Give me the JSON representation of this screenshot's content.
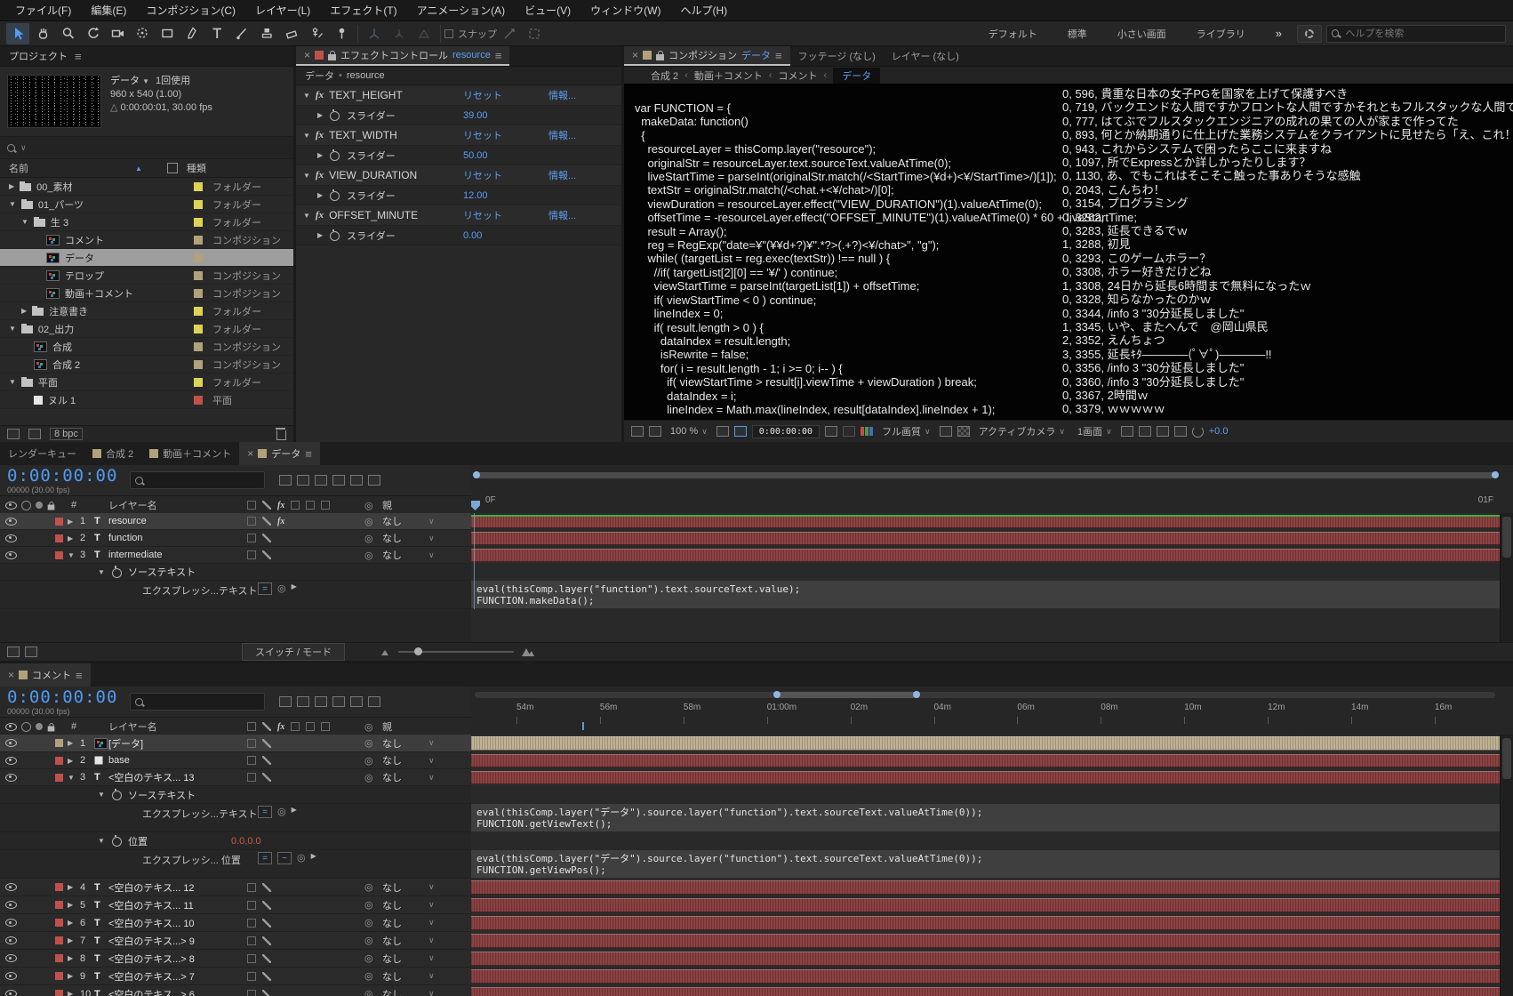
{
  "colors": {
    "accent_blue": "#5c9ff2",
    "timecode_blue": "#4f9bf5",
    "label_yellow": "#ddd453",
    "label_tan": "#b1a27c",
    "label_red": "#c0504a",
    "bar_red": "#8a4141",
    "bar_tan": "#bfb294",
    "green_line": "#3fae3f",
    "value_red": "#d05a50"
  },
  "menu_bar": {
    "items": [
      "ファイル(F)",
      "編集(E)",
      "コンポジション(C)",
      "レイヤー(L)",
      "エフェクト(T)",
      "アニメーション(A)",
      "ビュー(V)",
      "ウィンドウ(W)",
      "ヘルプ(H)"
    ]
  },
  "toolbar": {
    "snap_label": "スナップ",
    "workspaces": [
      "デフォルト",
      "標準",
      "小さい画面",
      "ライブラリ"
    ],
    "overflow": "»",
    "help_search_placeholder": "ヘルプを検索",
    "tools": [
      "selection",
      "hand",
      "zoom",
      "rotate",
      "camera",
      "orbit",
      "rectangle",
      "pen",
      "type",
      "brush",
      "stamp",
      "eraser",
      "roto-brush",
      "puppet-pin"
    ]
  },
  "project_panel": {
    "title": "プロジェクト",
    "preview": {
      "name": "データ",
      "usage": "1回使用",
      "dimensions": "960 x 540 (1.00)",
      "duration": "0:00:00:01, 30.00 fps"
    },
    "columns": {
      "name": "名前",
      "type": "種類"
    },
    "type_folder": "フォルダー",
    "type_comp": "コンポジション",
    "type_solid": "平面",
    "rows": [
      {
        "depth": 0,
        "exp": "r",
        "icon": "folder",
        "name": "00_素材",
        "color": "yellow",
        "type": "フォルダー"
      },
      {
        "depth": 0,
        "exp": "d",
        "icon": "folder",
        "name": "01_パーツ",
        "color": "yellow",
        "type": "フォルダー"
      },
      {
        "depth": 1,
        "exp": "d",
        "icon": "folder",
        "name": "生 3",
        "color": "yellow",
        "type": "フォルダー"
      },
      {
        "depth": 2,
        "exp": "",
        "icon": "comp",
        "name": "コメント",
        "color": "tan",
        "type": "コンポジション"
      },
      {
        "depth": 2,
        "exp": "",
        "icon": "comp",
        "name": "データ",
        "color": "tan",
        "type": "コンポジション",
        "selected": true
      },
      {
        "depth": 2,
        "exp": "",
        "icon": "comp",
        "name": "テロップ",
        "color": "tan",
        "type": "コンポジション"
      },
      {
        "depth": 2,
        "exp": "",
        "icon": "comp",
        "name": "動画＋コメント",
        "color": "tan",
        "type": "コンポジション"
      },
      {
        "depth": 1,
        "exp": "r",
        "icon": "folder",
        "name": "注意書き",
        "color": "yellow",
        "type": "フォルダー"
      },
      {
        "depth": 0,
        "exp": "d",
        "icon": "folder",
        "name": "02_出力",
        "color": "yellow",
        "type": "フォルダー"
      },
      {
        "depth": 1,
        "exp": "",
        "icon": "comp",
        "name": "合成",
        "color": "tan",
        "type": "コンポジション"
      },
      {
        "depth": 1,
        "exp": "",
        "icon": "comp",
        "name": "合成 2",
        "color": "tan",
        "type": "コンポジション"
      },
      {
        "depth": 0,
        "exp": "d",
        "icon": "folder",
        "name": "平面",
        "color": "yellow",
        "type": "フォルダー"
      },
      {
        "depth": 1,
        "exp": "",
        "icon": "solid",
        "name": "ヌル 1",
        "color": "red",
        "type": "平面"
      }
    ],
    "footer": {
      "bpc": "8 bpc"
    }
  },
  "effect_controls": {
    "tab_title": "エフェクトコントロール",
    "tab_target": "resource",
    "comp_name": "データ",
    "layer_name": "resource",
    "reset_label": "リセット",
    "info_label": "情報...",
    "slider_label": "スライダー",
    "effects": [
      {
        "name": "TEXT_HEIGHT",
        "value": "39.00"
      },
      {
        "name": "TEXT_WIDTH",
        "value": "50.00"
      },
      {
        "name": "VIEW_DURATION",
        "value": "12.00"
      },
      {
        "name": "OFFSET_MINUTE",
        "value": "0.00"
      }
    ]
  },
  "viewer": {
    "tab_comp_label": "コンポジション",
    "tab_comp_name": "データ",
    "tab_footage": "フッテージ (なし)",
    "tab_layer": "レイヤー (なし)",
    "breadcrumb": [
      "合成 2",
      "動画＋コメント",
      "コメント",
      "データ"
    ],
    "code_lines": [
      "var FUNCTION = {",
      "  makeData: function()",
      "  {",
      "    resourceLayer = thisComp.layer(\"resource\");",
      "    originalStr = resourceLayer.text.sourceText.valueAtTime(0);",
      "    liveStartTime = parseInt(originalStr.match(/<StartTime>(¥d+)<¥/StartTime>/)[1]);",
      "    textStr = originalStr.match(/<chat.+<¥/chat>/)[0];",
      "    viewDuration = resourceLayer.effect(\"VIEW_DURATION\")(1).valueAtTime(0);",
      "    offsetTime = -resourceLayer.effect(\"OFFSET_MINUTE\")(1).valueAtTime(0) * 60 + liveStartTime;",
      "    result = Array();",
      "    reg = RegExp(\"date=¥\"(¥¥d+?)¥\".*?>(.+?)<¥/chat>\", \"g\");",
      "    while( (targetList = reg.exec(textStr)) !== null ) {",
      "      //if( targetList[2][0] == '¥/' ) continue;",
      "      viewStartTime = parseInt(targetList[1]) + offsetTime;",
      "      if( viewStartTime < 0 ) continue;",
      "      lineIndex = 0;",
      "      if( result.length > 0 ) {",
      "        dataIndex = result.length;",
      "        isRewrite = false;",
      "        for( i = result.length - 1; i >= 0; i-- ) {",
      "          if( viewStartTime > result[i].viewTime + viewDuration ) break;",
      "          dataIndex = i;",
      "          lineIndex = Math.max(lineIndex, result[dataIndex].lineIndex + 1);"
    ],
    "chat_lines": [
      "0, 596, 貴重な日本の女子PGを国家を上げて保護すべき",
      "0, 719, バックエンドな人間ですかフロントな人間ですかそれともフルスタックな人間で",
      "0, 777, はてぶでフルスタックエンジニアの成れの果ての人が家まで作ってた",
      "0, 893, 何とか納期通りに仕上げた業務システムをクライアントに見せたら「え、これ！",
      "0, 943, これからシステムで困ったらここに来ますね",
      "0, 1097, 所でExpressとか詳しかったりします？",
      "0, 1130, あ、でもこれはそこそこ触った事ありそうな感触",
      "0, 2043, こんちわ！",
      "0, 3154, プログラミング",
      "0, 3262, ",
      "0, 3283, 延長できるでｗ",
      "1, 3288, 初見",
      "0, 3293, このゲームホラー？",
      "0, 3308, ホラー好きだけどね",
      "1, 3308, 24日から延長6時間まで無料になったｗ",
      "0, 3328, 知らなかったのかｗ",
      "0, 3344, /info 3 \"30分延長しました\"",
      "1, 3345, いや、またへんで　@岡山県民",
      "2, 3352, えんちょつ",
      "3, 3355, 延長ｷﾀ――――(ﾟ∀ﾟ)――――!!",
      "0, 3356, /info 3 \"30分延長しました\"",
      "0, 3360, /info 3 \"30分延長しました\"",
      "0, 3367, 2時間ｗ",
      "0, 3379, ｗｗｗｗｗ"
    ],
    "toolbar": {
      "zoom": "100 %",
      "timecode": "0:00:00:00",
      "quality": "フル画質",
      "camera": "アクティブカメラ",
      "layout": "1画面",
      "exposure": "+0.0"
    }
  },
  "timeline_data": {
    "tabs": [
      {
        "label": "レンダーキュー",
        "chip": false,
        "active": false
      },
      {
        "label": "合成 2",
        "chip": true,
        "active": false
      },
      {
        "label": "動画＋コメント",
        "chip": true,
        "active": false
      },
      {
        "label": "データ",
        "chip": true,
        "active": true
      }
    ],
    "timecode": "0:00:00:00",
    "frame_info": "00000 (30.00 fps)",
    "columns": {
      "num": "#",
      "layer": "レイヤー名",
      "parent": "親"
    },
    "parent_value": "なし",
    "layers": [
      {
        "num": "1",
        "name": "resource",
        "selected": true,
        "fx": true
      },
      {
        "num": "2",
        "name": "function",
        "selected": false,
        "fx": false
      },
      {
        "num": "3",
        "name": "intermediate",
        "selected": false,
        "fx": false,
        "expanded": true
      }
    ],
    "source_text_label": "ソーステキスト",
    "expression_label": "エクスプレッシ...テキスト",
    "expression_lines": [
      "eval(thisComp.layer(\"function\").text.sourceText.value);",
      "FUNCTION.makeData();"
    ],
    "ruler_start": "0F",
    "ruler_end": "01F",
    "footer_label": "スイッチ / モード"
  },
  "timeline_comment": {
    "tab": "コメント",
    "timecode": "0:00:00:00",
    "frame_info": "00000 (30.00 fps)",
    "columns": {
      "num": "#",
      "layer": "レイヤー名",
      "parent": "親"
    },
    "parent_value": "なし",
    "ruler_labels": [
      "54m",
      "56m",
      "58m",
      "01:00m",
      "02m",
      "04m",
      "06m",
      "08m",
      "10m",
      "12m",
      "14m",
      "16m"
    ],
    "layers": [
      {
        "num": "1",
        "name": "[データ]",
        "icon": "comp",
        "chip": "tan",
        "bar": "tan",
        "selected": true
      },
      {
        "num": "2",
        "name": "base",
        "icon": "solid",
        "chip": "red",
        "bar": "red",
        "selected": false
      },
      {
        "num": "3",
        "name": "<空白のテキス... 13",
        "icon": "T",
        "chip": "red",
        "bar": "red",
        "selected": false,
        "expanded": true
      }
    ],
    "more_layers": [
      {
        "num": "4",
        "name": "<空白のテキス... 12"
      },
      {
        "num": "5",
        "name": "<空白のテキス... 11"
      },
      {
        "num": "6",
        "name": "<空白のテキス... 10"
      },
      {
        "num": "7",
        "name": "<空白のテキス...> 9"
      },
      {
        "num": "8",
        "name": "<空白のテキス...> 8"
      },
      {
        "num": "9",
        "name": "<空白のテキス...> 7"
      },
      {
        "num": "10",
        "name": "<空白のテキス...> 6"
      }
    ],
    "source_text_label": "ソーステキスト",
    "expr_text_label": "エクスプレッシ...テキスト",
    "position_label": "位置",
    "position_value": "0.0,0.0",
    "expr_pos_label": "エクスプレッシ... 位置",
    "expr_text_lines": [
      "eval(thisComp.layer(\"データ\").source.layer(\"function\").text.sourceText.valueAtTime(0));",
      "FUNCTION.getViewText();"
    ],
    "expr_pos_lines": [
      "eval(thisComp.layer(\"データ\").source.layer(\"function\").text.sourceText.valueAtTime(0));",
      "FUNCTION.getViewPos();"
    ]
  }
}
